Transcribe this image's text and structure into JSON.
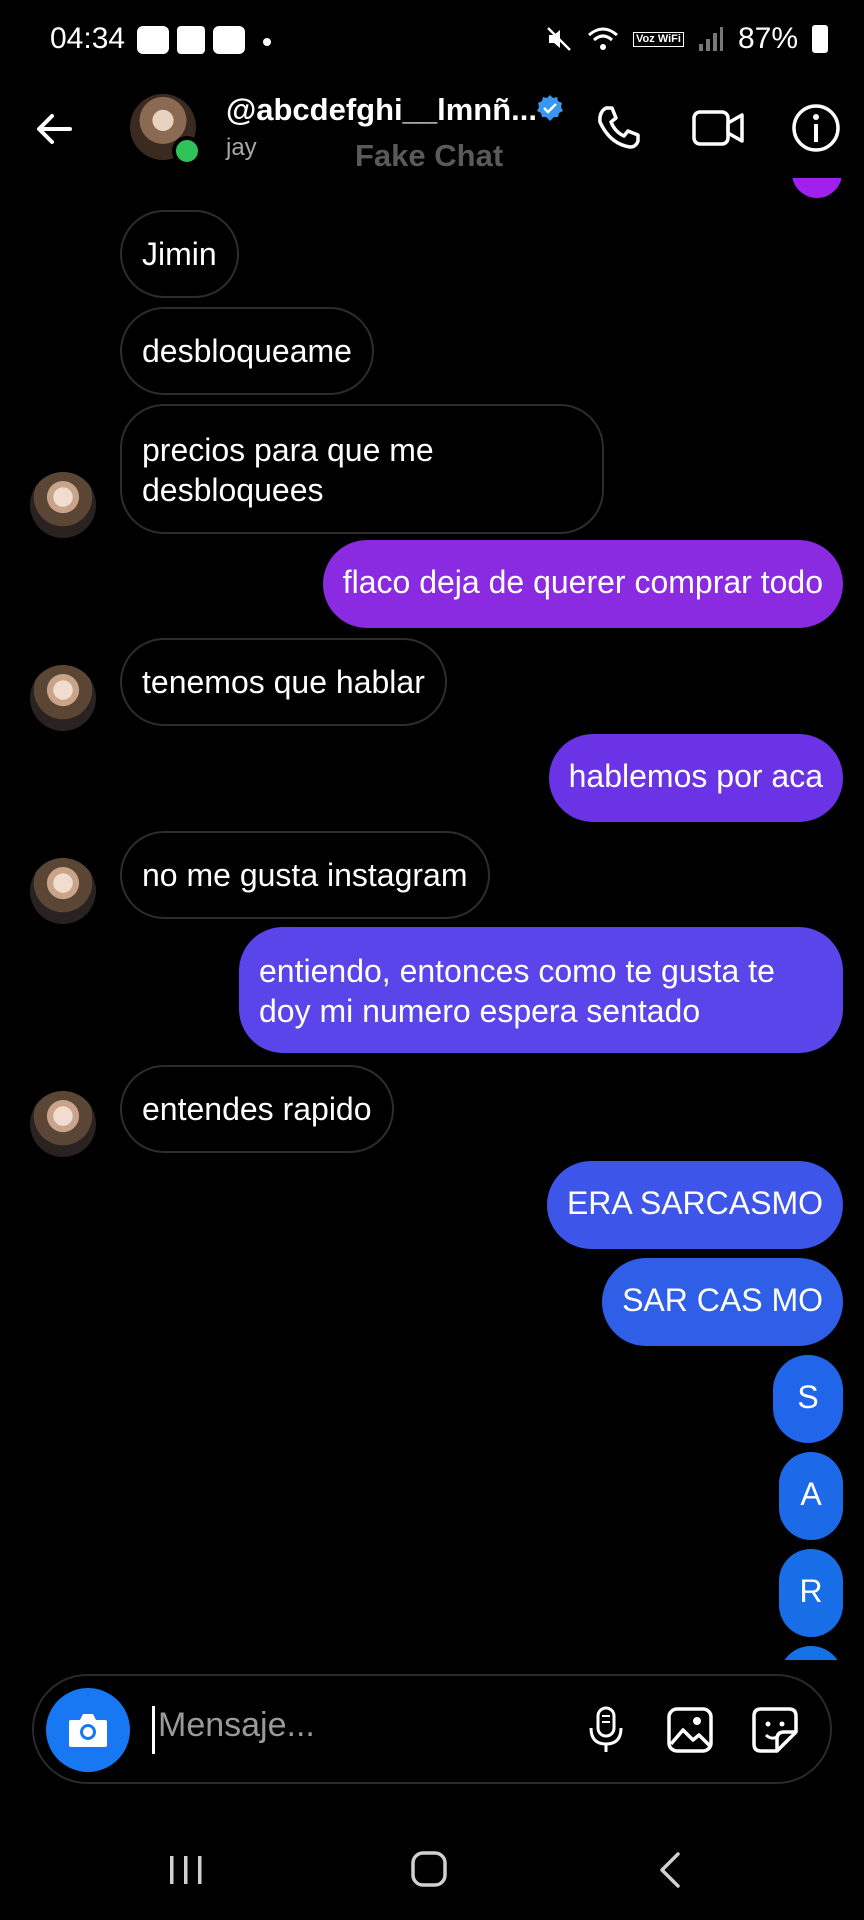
{
  "status_bar": {
    "time": "04:34",
    "battery": "87%",
    "volte": "Voz WiFi"
  },
  "header": {
    "username": "@abcdefghi__lmnñ...",
    "subname": "jay",
    "watermark": "Fake Chat",
    "online_color": "#2fc35a",
    "verified_color": "#3897f0"
  },
  "messages": [
    {
      "from": "them",
      "text": "Jimin"
    },
    {
      "from": "them",
      "text": "desbloqueame"
    },
    {
      "from": "them",
      "text": "precios para que me desbloquees"
    },
    {
      "from": "me",
      "text": "flaco deja de querer comprar todo",
      "color": "#8a2be2"
    },
    {
      "from": "them",
      "text": "tenemos que hablar"
    },
    {
      "from": "me",
      "text": "hablemos por aca",
      "color": "#6a34e6"
    },
    {
      "from": "them",
      "text": "no me gusta instagram"
    },
    {
      "from": "me",
      "text": "entiendo, entonces como te gusta te doy mi numero espera sentado",
      "color": "#5a45ea"
    },
    {
      "from": "them",
      "text": "entendes rapido"
    },
    {
      "from": "me",
      "text": "ERA SARCASMO",
      "color": "#3d55e8"
    },
    {
      "from": "me",
      "text": "SAR CAS MO",
      "color": "#2f5fe6"
    },
    {
      "from": "me",
      "text": "S",
      "color": "#2166ea"
    },
    {
      "from": "me",
      "text": "A",
      "color": "#1c6ae8"
    },
    {
      "from": "me",
      "text": "R",
      "color": "#186ee6"
    }
  ],
  "composer": {
    "placeholder": "Mensaje...",
    "camera_color": "#1877f2"
  },
  "icons": {
    "back": "arrow-left-icon",
    "call": "phone-icon",
    "video": "video-camera-icon",
    "info": "info-icon",
    "camera": "camera-icon",
    "mic": "microphone-icon",
    "gallery": "image-icon",
    "sticker": "sticker-icon"
  }
}
